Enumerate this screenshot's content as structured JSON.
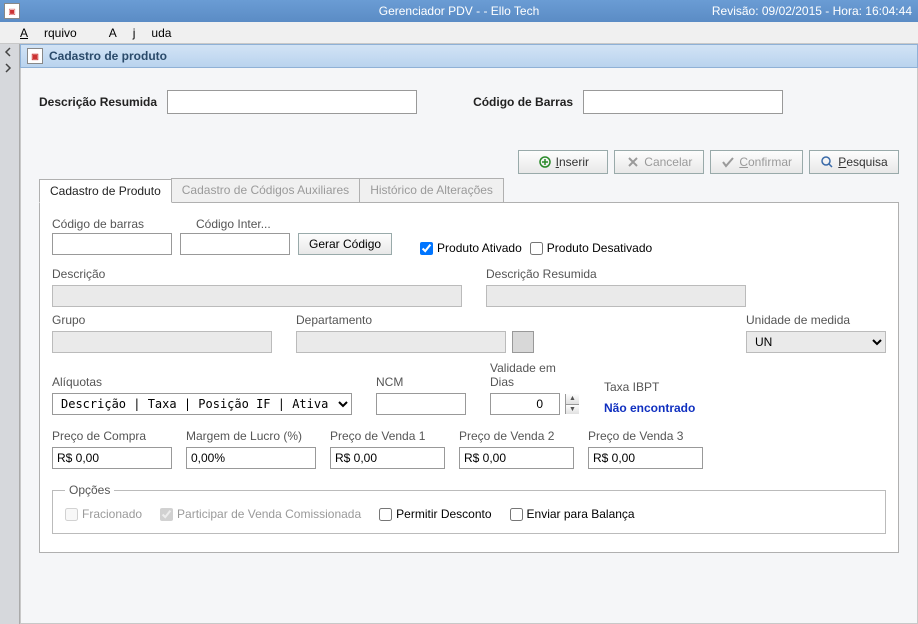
{
  "titlebar": {
    "app_title": "Gerenciador PDV - - Ello Tech",
    "revision": "Revisão:  09/02/2015 - Hora: 16:04:44"
  },
  "menu": {
    "file": "Arquivo",
    "help": "Ajuda"
  },
  "panel": {
    "title": "Cadastro de produto"
  },
  "header": {
    "desc_label": "Descrição Resumida",
    "barcode_label": "Código de Barras"
  },
  "buttons": {
    "insert": "Inserir",
    "cancel": "Cancelar",
    "confirm": "Confirmar",
    "search": "Pesquisa"
  },
  "tabs": {
    "cadastro": "Cadastro de Produto",
    "codigos": "Cadastro de Códigos Auxiliares",
    "historico": "Histórico de Alterações"
  },
  "form": {
    "codigo_barras": "Código de barras",
    "codigo_interno": "Código Inter...",
    "gerar_codigo": "Gerar Código",
    "prod_ativado": "Produto Ativado",
    "prod_desativado": "Produto Desativado",
    "descricao": "Descrição",
    "descricao_resumida": "Descrição Resumida",
    "grupo": "Grupo",
    "departamento": "Departamento",
    "unidade": "Unidade de medida",
    "unidade_value": "UN",
    "aliquotas": "Alíquotas",
    "aliquotas_value": "Descrição | Taxa | Posição IF | Ativa",
    "ncm": "NCM",
    "validade": "Validade em Dias",
    "validade_value": "0",
    "taxa_ibpt": "Taxa IBPT",
    "ibpt_value": "Não encontrado",
    "preco_compra": "Preço de Compra",
    "margem": "Margem de Lucro (%)",
    "preco_v1": "Preço de Venda 1",
    "preco_v2": "Preço de Venda 2",
    "preco_v3": "Preço de Venda 3",
    "money_zero": "R$ 0,00",
    "pct_zero": "0,00%"
  },
  "options": {
    "legend": "Opções",
    "fracionado": "Fracionado",
    "comissionada": "Participar de Venda Comissionada",
    "desconto": "Permitir Desconto",
    "balanca": "Enviar para Balança"
  }
}
